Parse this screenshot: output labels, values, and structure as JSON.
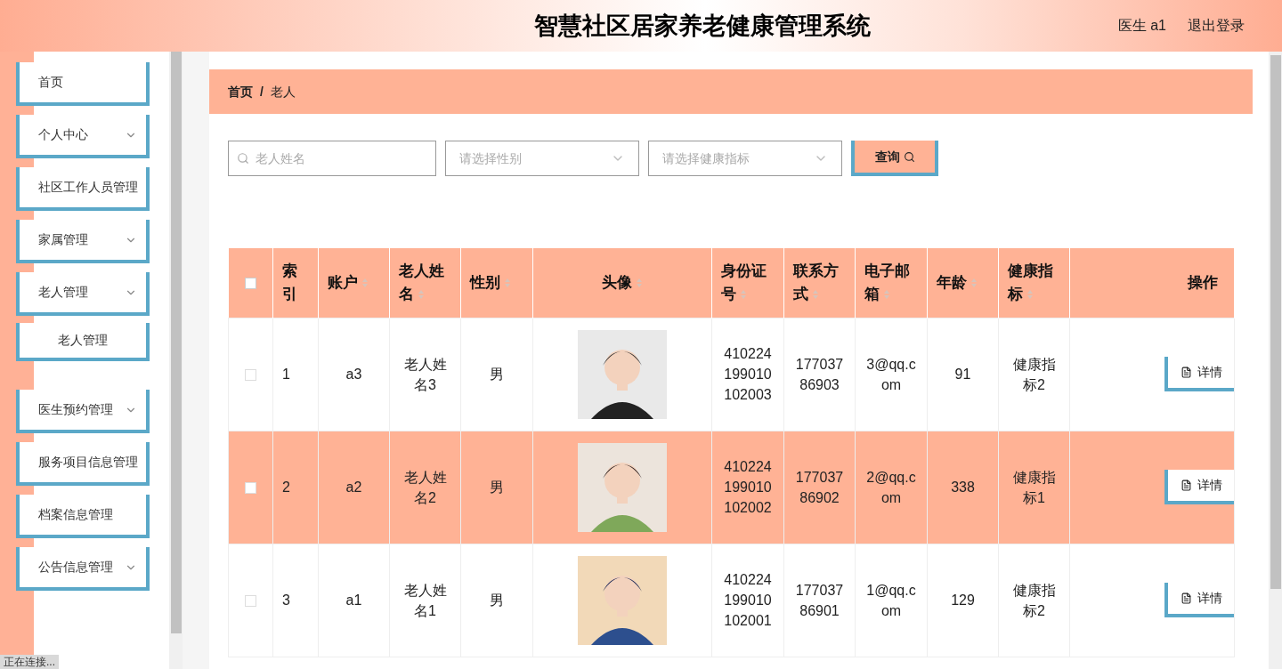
{
  "header": {
    "title": "智慧社区居家养老健康管理系统",
    "user": "医生 a1",
    "logout": "退出登录"
  },
  "sidebar": {
    "items": [
      {
        "label": "首页",
        "has_submenu": false
      },
      {
        "label": "个人中心",
        "has_submenu": true
      },
      {
        "label": "社区工作人员管理",
        "has_submenu": false
      },
      {
        "label": "家属管理",
        "has_submenu": true
      },
      {
        "label": "老人管理",
        "has_submenu": true,
        "children": [
          {
            "label": "老人管理"
          }
        ]
      },
      {
        "label": "医生预约管理",
        "has_submenu": true
      },
      {
        "label": "服务项目信息管理",
        "has_submenu": false
      },
      {
        "label": "档案信息管理",
        "has_submenu": false
      },
      {
        "label": "公告信息管理",
        "has_submenu": true
      }
    ]
  },
  "breadcrumb": [
    "首页",
    "老人"
  ],
  "breadcrumb_separator": "/",
  "filters": {
    "name_placeholder": "老人姓名",
    "gender_placeholder": "请选择性别",
    "health_placeholder": "请选择健康指标",
    "search_button": "查询"
  },
  "table": {
    "select_all": {
      "checked": false
    },
    "columns": [
      {
        "label": "索引",
        "sortable": false
      },
      {
        "label": "账户",
        "sortable": true
      },
      {
        "label": "老人姓名",
        "sortable": true
      },
      {
        "label": "性别",
        "sortable": true
      },
      {
        "label": "头像",
        "sortable": true
      },
      {
        "label": "身份证号",
        "sortable": true
      },
      {
        "label": "联系方式",
        "sortable": true
      },
      {
        "label": "电子邮箱",
        "sortable": true
      },
      {
        "label": "年龄",
        "sortable": true
      },
      {
        "label": "健康指标",
        "sortable": true
      },
      {
        "label": "操作",
        "sortable": false
      }
    ],
    "rows": [
      {
        "checked": false,
        "highlighted": false,
        "index": "1",
        "account": "a3",
        "name": "老人姓名3",
        "gender": "男",
        "id_number": "410224199010102003",
        "phone": "17703786903",
        "email": "3@qq.com",
        "age": "91",
        "health": "健康指标2",
        "action": "详情"
      },
      {
        "checked": false,
        "highlighted": true,
        "index": "2",
        "account": "a2",
        "name": "老人姓名2",
        "gender": "男",
        "id_number": "410224199010102002",
        "phone": "17703786902",
        "email": "2@qq.com",
        "age": "338",
        "health": "健康指标1",
        "action": "详情"
      },
      {
        "checked": false,
        "highlighted": false,
        "index": "3",
        "account": "a1",
        "name": "老人姓名1",
        "gender": "男",
        "id_number": "410224199010102001",
        "phone": "17703786901",
        "email": "1@qq.com",
        "age": "129",
        "health": "健康指标2",
        "action": "详情"
      }
    ]
  },
  "status_bar": "正在连接..."
}
